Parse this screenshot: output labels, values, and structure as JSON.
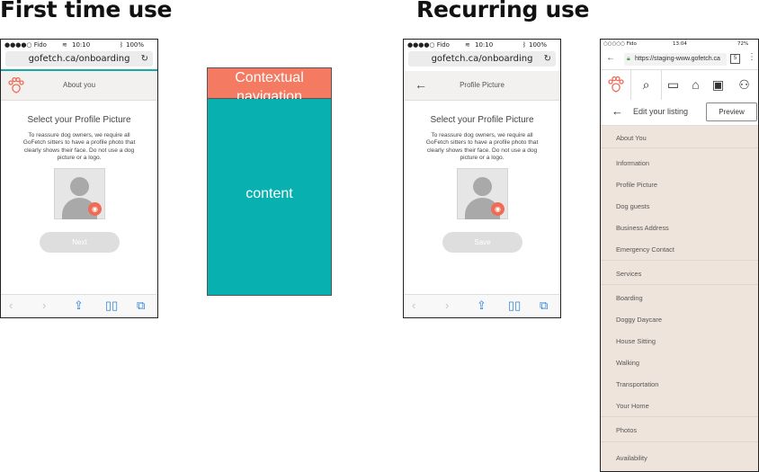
{
  "headings": {
    "first": "First time use",
    "recurring": "Recurring use"
  },
  "phone1": {
    "status": {
      "carrier": "●●●●○ Fido",
      "time": "10:10",
      "battery": "100%"
    },
    "url": "gofetch.ca/onboarding",
    "app_title": "About you",
    "title": "Select your Profile Picture",
    "description": "To reassure dog owners, we require all GoFetch sitters to have a profile photo that clearly shows their face. Do not use a dog picture or a logo.",
    "button": "Next"
  },
  "wireframe": {
    "nav": "Contextual navigation",
    "content": "content"
  },
  "phone2": {
    "status": {
      "carrier": "●●●●○ Fido",
      "time": "10:10",
      "battery": "100%"
    },
    "url": "gofetch.ca/onboarding",
    "app_title": "Profile Picture",
    "title": "Select your Profile Picture",
    "description": "To reassure dog owners, we require all GoFetch sitters to have a profile photo that clearly shows their face. Do not use a dog picture or a logo.",
    "button": "Save"
  },
  "phone3": {
    "status": {
      "carrier": "○○○○○ Fido",
      "time": "13:04",
      "battery": "72%"
    },
    "url": "https://staging-www.gofetch.ca",
    "tab_count": "5",
    "edit_label": "Edit your listing",
    "preview": "Preview",
    "items": [
      "About You",
      "Information",
      "Profile Picture",
      "Dog guests",
      "Business Address",
      "Emergency Contact",
      "Services",
      "Boarding",
      "Doggy Daycare",
      "House Sitting",
      "Walking",
      "Transportation",
      "Your Home",
      "Photos",
      "Availability"
    ]
  },
  "colors": {
    "accent": "#f47a62",
    "teal": "#08b0b0",
    "link_blue": "#2f84d8"
  },
  "icons": [
    "paw-logo-icon",
    "search-icon",
    "chat-icon",
    "home-icon",
    "briefcase-icon",
    "user-icon",
    "camera-icon",
    "back-icon",
    "share-icon",
    "bookmarks-icon",
    "tabs-icon",
    "reload-icon"
  ]
}
